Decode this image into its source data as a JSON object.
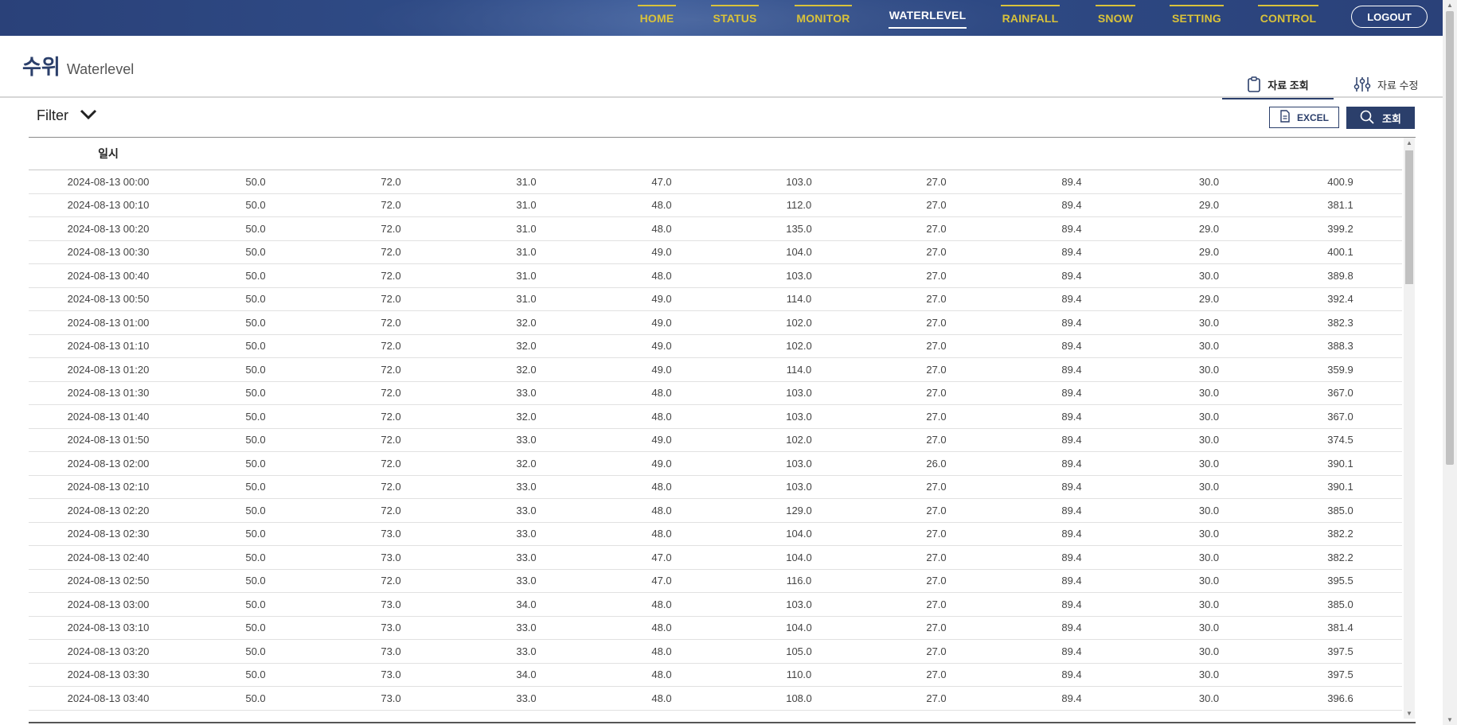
{
  "nav": {
    "items": [
      {
        "label": "HOME",
        "active": false
      },
      {
        "label": "STATUS",
        "active": false
      },
      {
        "label": "MONITOR",
        "active": false
      },
      {
        "label": "WATERLEVEL",
        "active": true
      },
      {
        "label": "RAINFALL",
        "active": false
      },
      {
        "label": "SNOW",
        "active": false
      },
      {
        "label": "SETTING",
        "active": false
      },
      {
        "label": "CONTROL",
        "active": false
      }
    ],
    "logout_label": "LOGOUT"
  },
  "page": {
    "title_ko": "수위",
    "title_en": "Waterlevel"
  },
  "tabs": {
    "view_label": "자료 조회",
    "edit_label": "자료 수정"
  },
  "filter": {
    "label": "Filter",
    "excel_label": "EXCEL",
    "search_label": "조회"
  },
  "table": {
    "headers": [
      "일시",
      "",
      "",
      "",
      "",
      "",
      "",
      "",
      "",
      ""
    ],
    "rows": [
      [
        "2024-08-13 00:00",
        "50.0",
        "72.0",
        "31.0",
        "47.0",
        "103.0",
        "27.0",
        "89.4",
        "30.0",
        "400.9"
      ],
      [
        "2024-08-13 00:10",
        "50.0",
        "72.0",
        "31.0",
        "48.0",
        "112.0",
        "27.0",
        "89.4",
        "29.0",
        "381.1"
      ],
      [
        "2024-08-13 00:20",
        "50.0",
        "72.0",
        "31.0",
        "48.0",
        "135.0",
        "27.0",
        "89.4",
        "29.0",
        "399.2"
      ],
      [
        "2024-08-13 00:30",
        "50.0",
        "72.0",
        "31.0",
        "49.0",
        "104.0",
        "27.0",
        "89.4",
        "29.0",
        "400.1"
      ],
      [
        "2024-08-13 00:40",
        "50.0",
        "72.0",
        "31.0",
        "48.0",
        "103.0",
        "27.0",
        "89.4",
        "30.0",
        "389.8"
      ],
      [
        "2024-08-13 00:50",
        "50.0",
        "72.0",
        "31.0",
        "49.0",
        "114.0",
        "27.0",
        "89.4",
        "29.0",
        "392.4"
      ],
      [
        "2024-08-13 01:00",
        "50.0",
        "72.0",
        "32.0",
        "49.0",
        "102.0",
        "27.0",
        "89.4",
        "30.0",
        "382.3"
      ],
      [
        "2024-08-13 01:10",
        "50.0",
        "72.0",
        "32.0",
        "49.0",
        "102.0",
        "27.0",
        "89.4",
        "30.0",
        "388.3"
      ],
      [
        "2024-08-13 01:20",
        "50.0",
        "72.0",
        "32.0",
        "49.0",
        "114.0",
        "27.0",
        "89.4",
        "30.0",
        "359.9"
      ],
      [
        "2024-08-13 01:30",
        "50.0",
        "72.0",
        "33.0",
        "48.0",
        "103.0",
        "27.0",
        "89.4",
        "30.0",
        "367.0"
      ],
      [
        "2024-08-13 01:40",
        "50.0",
        "72.0",
        "32.0",
        "48.0",
        "103.0",
        "27.0",
        "89.4",
        "30.0",
        "367.0"
      ],
      [
        "2024-08-13 01:50",
        "50.0",
        "72.0",
        "33.0",
        "49.0",
        "102.0",
        "27.0",
        "89.4",
        "30.0",
        "374.5"
      ],
      [
        "2024-08-13 02:00",
        "50.0",
        "72.0",
        "32.0",
        "49.0",
        "103.0",
        "26.0",
        "89.4",
        "30.0",
        "390.1"
      ],
      [
        "2024-08-13 02:10",
        "50.0",
        "72.0",
        "33.0",
        "48.0",
        "103.0",
        "27.0",
        "89.4",
        "30.0",
        "390.1"
      ],
      [
        "2024-08-13 02:20",
        "50.0",
        "72.0",
        "33.0",
        "48.0",
        "129.0",
        "27.0",
        "89.4",
        "30.0",
        "385.0"
      ],
      [
        "2024-08-13 02:30",
        "50.0",
        "73.0",
        "33.0",
        "48.0",
        "104.0",
        "27.0",
        "89.4",
        "30.0",
        "382.2"
      ],
      [
        "2024-08-13 02:40",
        "50.0",
        "73.0",
        "33.0",
        "47.0",
        "104.0",
        "27.0",
        "89.4",
        "30.0",
        "382.2"
      ],
      [
        "2024-08-13 02:50",
        "50.0",
        "72.0",
        "33.0",
        "47.0",
        "116.0",
        "27.0",
        "89.4",
        "30.0",
        "395.5"
      ],
      [
        "2024-08-13 03:00",
        "50.0",
        "73.0",
        "34.0",
        "48.0",
        "103.0",
        "27.0",
        "89.4",
        "30.0",
        "385.0"
      ],
      [
        "2024-08-13 03:10",
        "50.0",
        "73.0",
        "33.0",
        "48.0",
        "104.0",
        "27.0",
        "89.4",
        "30.0",
        "381.4"
      ],
      [
        "2024-08-13 03:20",
        "50.0",
        "73.0",
        "33.0",
        "48.0",
        "105.0",
        "27.0",
        "89.4",
        "30.0",
        "397.5"
      ],
      [
        "2024-08-13 03:30",
        "50.0",
        "73.0",
        "34.0",
        "48.0",
        "110.0",
        "27.0",
        "89.4",
        "30.0",
        "397.5"
      ],
      [
        "2024-08-13 03:40",
        "50.0",
        "73.0",
        "33.0",
        "48.0",
        "108.0",
        "27.0",
        "89.4",
        "30.0",
        "396.6"
      ]
    ]
  },
  "colors": {
    "nav_bg": "#2f4b86",
    "nav_text": "#d9c23a",
    "primary": "#2b3f6b"
  },
  "icons": {
    "tab_view": "clipboard-icon",
    "tab_edit": "sliders-icon",
    "filter_toggle": "chevron-down-icon",
    "excel": "document-icon",
    "search": "search-icon"
  }
}
